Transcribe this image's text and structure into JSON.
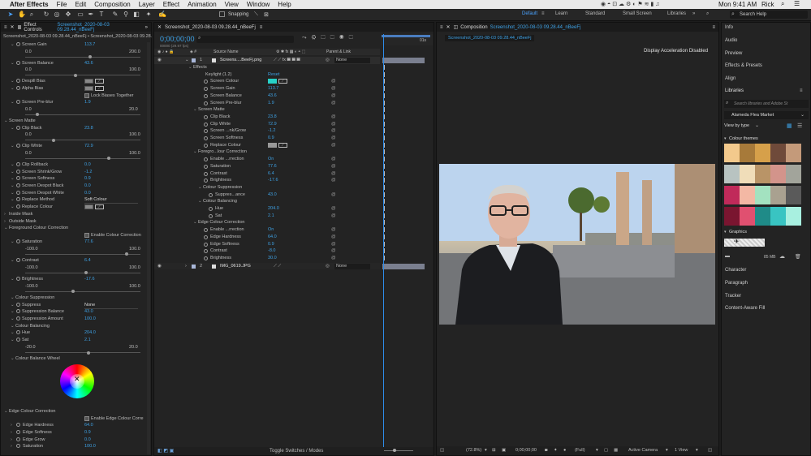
{
  "menubar": {
    "app": "After Effects",
    "items": [
      "File",
      "Edit",
      "Composition",
      "Layer",
      "Effect",
      "Animation",
      "View",
      "Window",
      "Help"
    ],
    "clock": "Mon 9:41 AM",
    "user": "Rick"
  },
  "toolbar": {
    "snapping": "Snapping",
    "workspaces": [
      "Default",
      "Learn",
      "Standard",
      "Small Screen",
      "Libraries"
    ],
    "search_placeholder": "Search Help"
  },
  "effect_controls": {
    "tab": "Effect Controls",
    "tab_target": "Screenshot_2020-08-03 09.28.44_nBeeFj",
    "header": "Screenshot_2020-08-03 09.28.44_nBeeFj • Screenshot_2020-08-03 09.28.44_nBeeFj",
    "rows": [
      {
        "label": "Screen Gain",
        "value": "113.7"
      },
      {
        "label": "",
        "value": "0.0",
        "max": "200.0"
      },
      {
        "label": "Screen Balance",
        "value": "43.6"
      },
      {
        "label": "",
        "value": "0.0",
        "max": "100.0"
      },
      {
        "label": "Despill Bias",
        "value": ""
      },
      {
        "label": "Alpha Bias",
        "value": ""
      },
      {
        "label": "",
        "value": "Lock Biases Together"
      },
      {
        "label": "Screen Pre-blur",
        "value": "1.9"
      },
      {
        "label": "",
        "value": "0.0",
        "max": "20.0"
      },
      {
        "label": "Screen Matte",
        "value": ""
      },
      {
        "label": "Clip Black",
        "value": "23.8"
      },
      {
        "label": "",
        "value": "0.0",
        "max": "100.0"
      },
      {
        "label": "Clip White",
        "value": "72.9"
      },
      {
        "label": "",
        "value": "0.0",
        "max": "100.0"
      },
      {
        "label": "Clip Rollback",
        "value": "0.0"
      },
      {
        "label": "Screen Shrink/Grow",
        "value": "-1.2"
      },
      {
        "label": "Screen Softness",
        "value": "0.9"
      },
      {
        "label": "Screen Despot Black",
        "value": "0.0"
      },
      {
        "label": "Screen Despot White",
        "value": "0.0"
      },
      {
        "label": "Replace Method",
        "value": "Soft Colour"
      },
      {
        "label": "Replace Colour",
        "value": ""
      },
      {
        "label": "Inside Mask",
        "value": ""
      },
      {
        "label": "Outside Mask",
        "value": ""
      },
      {
        "label": "Foreground Colour Correction",
        "value": ""
      },
      {
        "label": "",
        "value": "Enable Colour Correction"
      },
      {
        "label": "Saturation",
        "value": "77.6"
      },
      {
        "label": "",
        "value": "-100.0",
        "max": "100.0"
      },
      {
        "label": "Contrast",
        "value": "6.4"
      },
      {
        "label": "",
        "value": "-100.0",
        "max": "100.0"
      },
      {
        "label": "Brightness",
        "value": "-17.6"
      },
      {
        "label": "",
        "value": "-100.0",
        "max": "100.0"
      },
      {
        "label": "Colour Suppression",
        "value": ""
      },
      {
        "label": "Suppress",
        "value": "None"
      },
      {
        "label": "Suppression Balance",
        "value": "43.0"
      },
      {
        "label": "Suppression Amount",
        "value": "100.0"
      },
      {
        "label": "Colour Balancing",
        "value": ""
      },
      {
        "label": "Hue",
        "value": "204.0"
      },
      {
        "label": "Sat",
        "value": "2.1"
      },
      {
        "label": "",
        "value": "-20.0",
        "max": "20.0"
      },
      {
        "label": "Colour Balance Wheel",
        "value": ""
      }
    ],
    "edge_rows": [
      {
        "label": "Edge Colour Correction",
        "value": ""
      },
      {
        "label": "",
        "value": "Enable Edge Colour Corre"
      },
      {
        "label": "Edge Hardness",
        "value": "64.0"
      },
      {
        "label": "Edge Softness",
        "value": "0.9"
      },
      {
        "label": "Edge Grow",
        "value": "0.0"
      },
      {
        "label": "Saturation",
        "value": "100.0"
      }
    ]
  },
  "timeline": {
    "tab": "Screenshot_2020-08-03 09.28.44_nBeeFj",
    "timecode": "0;00;00;00",
    "frames": "00000 (29.97 fps)",
    "col_source": "Source Name",
    "col_parent": "Parent & Link",
    "ruler_end": "01s",
    "layers": [
      {
        "num": "1",
        "name": "Screens....BeeFj.png",
        "parent": "None"
      },
      {
        "num": "2",
        "name": "IMG_0619.JPG",
        "parent": "None"
      }
    ],
    "props": [
      {
        "label": "Effects",
        "value": "",
        "indent": 1
      },
      {
        "label": "Keylight (1.2)",
        "value": "Reset",
        "indent": 2
      },
      {
        "label": "Screen Colour",
        "value": "",
        "indent": 3
      },
      {
        "label": "Screen Gain",
        "value": "113.7",
        "indent": 3
      },
      {
        "label": "Screen Balance",
        "value": "43.6",
        "indent": 3
      },
      {
        "label": "Screen Pre-blur",
        "value": "1.9",
        "indent": 3
      },
      {
        "label": "Screen Matte",
        "value": "",
        "indent": 2
      },
      {
        "label": "Clip Black",
        "value": "23.8",
        "indent": 3
      },
      {
        "label": "Clip White",
        "value": "72.9",
        "indent": 3
      },
      {
        "label": "Screen ...nk/Grow",
        "value": "-1.2",
        "indent": 3
      },
      {
        "label": "Screen Softness",
        "value": "0.9",
        "indent": 3
      },
      {
        "label": "Replace Colour",
        "value": "",
        "indent": 3
      },
      {
        "label": "Foregro...lour Correction",
        "value": "",
        "indent": 2
      },
      {
        "label": "Enable ...rrection",
        "value": "On",
        "indent": 3
      },
      {
        "label": "Saturation",
        "value": "77.6",
        "indent": 3
      },
      {
        "label": "Contrast",
        "value": "6.4",
        "indent": 3
      },
      {
        "label": "Brightness",
        "value": "-17.6",
        "indent": 3
      },
      {
        "label": "Colour Suppression",
        "value": "",
        "indent": 3
      },
      {
        "label": "Suppres...ance",
        "value": "43.0",
        "indent": 4
      },
      {
        "label": "Colour Balancing",
        "value": "",
        "indent": 3
      },
      {
        "label": "Hue",
        "value": "204.0",
        "indent": 4
      },
      {
        "label": "Sat",
        "value": "2.1",
        "indent": 4
      },
      {
        "label": "Edge Colour Correction",
        "value": "",
        "indent": 2
      },
      {
        "label": "Enable ...rrection",
        "value": "On",
        "indent": 3
      },
      {
        "label": "Edge Hardness",
        "value": "64.0",
        "indent": 3
      },
      {
        "label": "Edge Softness",
        "value": "0.9",
        "indent": 3
      },
      {
        "label": "Contrast",
        "value": "-8.0",
        "indent": 3
      },
      {
        "label": "Brightness",
        "value": "30.0",
        "indent": 3
      }
    ],
    "footer": "Toggle Switches / Modes"
  },
  "composition": {
    "tab_prefix": "Composition",
    "tab_name": "Screenshot_2020-08-03 09.28.44_nBeeFj",
    "sub_tab": "Screenshot_2020-08-03 09.28.44_nBeeFj",
    "notice": "Display Acceleration Disabled",
    "zoom": "(72.8%)",
    "timecode": "0;00;00;00",
    "resolution": "(Full)",
    "camera": "Active Camera",
    "views": "1 View"
  },
  "right_panel": {
    "items": [
      "Info",
      "Audio",
      "Preview",
      "Effects & Presets",
      "Align"
    ],
    "libraries": "Libraries",
    "search_placeholder": "Search libraries and Adobe St",
    "library_name": "Alameda Flea Market",
    "view_by": "View by type",
    "colour_themes": "Colour themes",
    "graphics": "Graphics",
    "storage": "85 MB",
    "bottom_items": [
      "Character",
      "Paragraph",
      "Tracker",
      "Content-Aware Fill"
    ],
    "swatches": [
      [
        "#f3c98c",
        "#a77a3a",
        "#d6a04a",
        "#6f4a3a",
        "#c49a7a"
      ],
      [
        "#b8c3c1",
        "#f0ddb9",
        "#b99467",
        "#d3948b",
        "#a2a49b"
      ],
      [
        "#c02a5a",
        "#f3b8a4",
        "#a3e2c0",
        "#a9a190",
        "#5a5a5a"
      ],
      [
        "#7a1530",
        "#e05070",
        "#1f8b88",
        "#39c4c2",
        "#a8f0e0"
      ]
    ]
  }
}
